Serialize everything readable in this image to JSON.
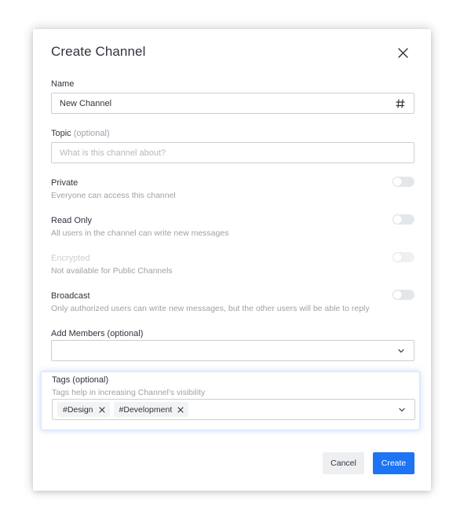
{
  "modal": {
    "title": "Create Channel",
    "close_icon": "close-icon"
  },
  "name_field": {
    "label": "Name",
    "value": "New Channel",
    "icon": "hash-icon"
  },
  "topic_field": {
    "label": "Topic",
    "label_optional": "(optional)",
    "placeholder": "What is this channel about?"
  },
  "options": [
    {
      "title": "Private",
      "description": "Everyone can access this channel",
      "enabled": false,
      "disabled": false
    },
    {
      "title": "Read Only",
      "description": "All users in the channel can write new messages",
      "enabled": false,
      "disabled": false
    },
    {
      "title": "Encrypted",
      "description": "Not available for Public Channels",
      "enabled": false,
      "disabled": true
    },
    {
      "title": "Broadcast",
      "description": "Only authorized users can write new messages, but the other users will be able to reply",
      "enabled": false,
      "disabled": false
    }
  ],
  "members_field": {
    "label": "Add Members (optional)",
    "icon": "chevron-down-icon"
  },
  "tags_field": {
    "label": "Tags (optional)",
    "description": "Tags help in increasing Channel's visibility",
    "tags": [
      "#Design",
      "#Development"
    ],
    "icon": "chevron-down-icon"
  },
  "actions": {
    "cancel_label": "Cancel",
    "create_label": "Create"
  },
  "colors": {
    "primary": "#1d74f5",
    "text": "#2f343d",
    "hint": "#9ea2a8",
    "border": "#cbced1"
  }
}
